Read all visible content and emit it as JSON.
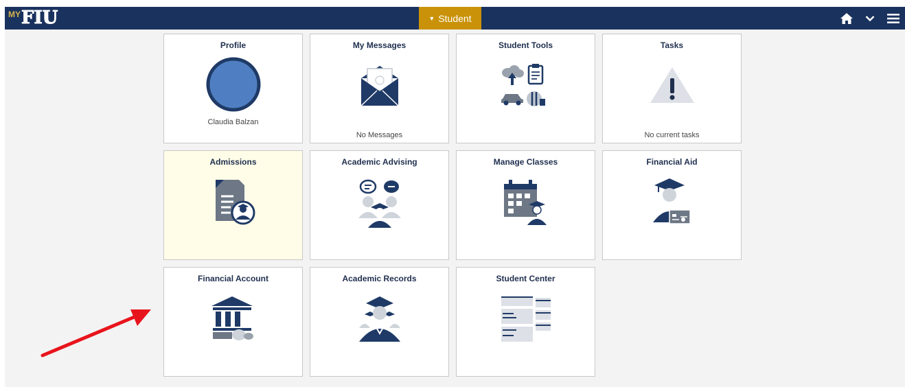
{
  "header": {
    "logo_my": "MY",
    "logo_text": "FIU",
    "homepage_selector": "Student",
    "icons": [
      "home-icon",
      "chevron-down-icon",
      "hamburger-menu-icon"
    ]
  },
  "tiles": {
    "profile": {
      "title": "Profile",
      "subtitle": "Claudia Balzan"
    },
    "messages": {
      "title": "My Messages",
      "subtitle": "No Messages"
    },
    "student_tools": {
      "title": "Student Tools"
    },
    "tasks": {
      "title": "Tasks",
      "subtitle": "No current tasks"
    },
    "admissions": {
      "title": "Admissions"
    },
    "academic_advising": {
      "title": "Academic Advising"
    },
    "manage_classes": {
      "title": "Manage Classes"
    },
    "financial_aid": {
      "title": "Financial Aid"
    },
    "financial_account": {
      "title": "Financial Account"
    },
    "academic_records": {
      "title": "Academic Records"
    },
    "student_center": {
      "title": "Student Center"
    }
  },
  "colors": {
    "header_bg": "#1a325e",
    "selector_bg": "#c99208",
    "icon_navy": "#1f3a66",
    "icon_gray": "#6d7785",
    "annotation_arrow": "#e8141c",
    "highlight_tile": "#fffde8"
  }
}
